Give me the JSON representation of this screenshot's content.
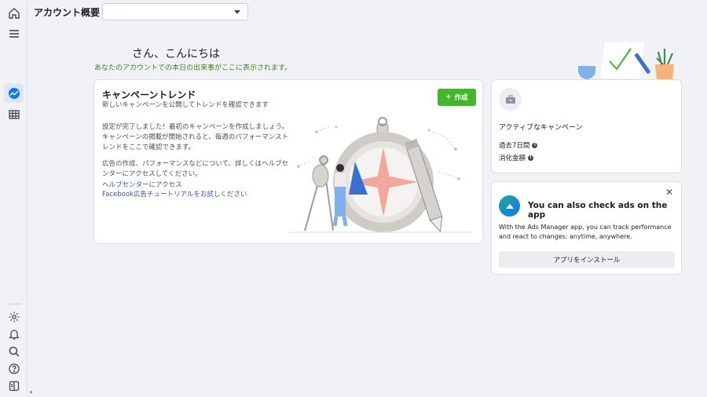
{
  "header": {
    "title": "アカウント概要",
    "account_value": ""
  },
  "greeting": {
    "hello": "さん、こんにちは",
    "subtitle": "あなたのアカウントでの本日の出来事がここに表示されます。"
  },
  "campaign_trends": {
    "title": "キャンペーントレンド",
    "subtitle": "新しいキャンペーンを公開してトレンドを確認できます",
    "create_label": "作成",
    "paragraph1": "設定が完了しました！最初のキャンペーンを作成しましょう。キャンペーンの掲載が開始されると、毎週のパフォーマンストレンドをここで確認できます。",
    "paragraph2": "広告の作成、パフォーマンスなどについて、詳しくはヘルプセンターにアクセスしてください。",
    "link_help": "ヘルプセンターにアクセス",
    "link_tutorial": "Facebook広告チュートリアルをお試しください"
  },
  "active_campaigns": {
    "title": "アクティブなキャンペーン",
    "metric1": "過去7日間",
    "metric2": "消化金額"
  },
  "app_promo": {
    "close": "✕",
    "title": "You can also check ads on the app",
    "description": "With the Ads Manager app, you can track performance and react to changes: anytime, anywhere.",
    "install_label": "アプリをインストール"
  },
  "colors": {
    "accent_green": "#42b72a",
    "link_blue": "#385898",
    "rail_active": "#1877f2",
    "greeting_green": "#4b7f1f"
  },
  "icons": [
    "home-icon",
    "menu-icon",
    "ads-manager-icon",
    "table-icon",
    "settings-icon",
    "bell-icon",
    "search-icon",
    "help-icon",
    "panel-icon"
  ]
}
